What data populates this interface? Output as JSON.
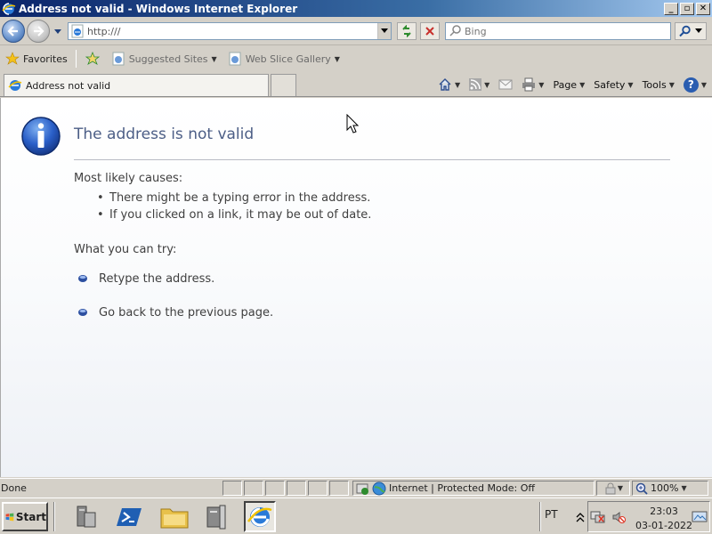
{
  "window": {
    "title": "Address not valid - Windows Internet Explorer",
    "buttons": {
      "minimize": "_",
      "maximize": "▫",
      "close": "✕"
    }
  },
  "toolbar": {
    "address_value": "http:///",
    "search_placeholder": "Bing"
  },
  "favorites_bar": {
    "favorites_label": "Favorites",
    "items": [
      {
        "label": "Suggested Sites",
        "icon": "ie-page-icon"
      },
      {
        "label": "Web Slice Gallery",
        "icon": "ie-page-icon"
      }
    ]
  },
  "tabs": [
    {
      "label": "Address not valid",
      "active": true
    }
  ],
  "command_bar": {
    "page": "Page",
    "safety": "Safety",
    "tools": "Tools",
    "help": "?"
  },
  "content": {
    "title": "The address is not valid",
    "causes_heading": "Most likely causes:",
    "causes": [
      "There might be a typing error in the address.",
      "If you clicked on a link, it may be out of date."
    ],
    "try_heading": "What you can try:",
    "tries": [
      "Retype the address.",
      "Go back to the previous page."
    ]
  },
  "statusbar": {
    "status": "Done",
    "zone": "Internet | Protected Mode: Off",
    "zoom": "100%"
  },
  "taskbar": {
    "start_label": "Start",
    "language": "PT",
    "time": "23:03",
    "date": "03-01-2022"
  },
  "colors": {
    "title_text": "#4c5e86",
    "titlebar_start": "#0a246a",
    "titlebar_end": "#a6caf0"
  }
}
